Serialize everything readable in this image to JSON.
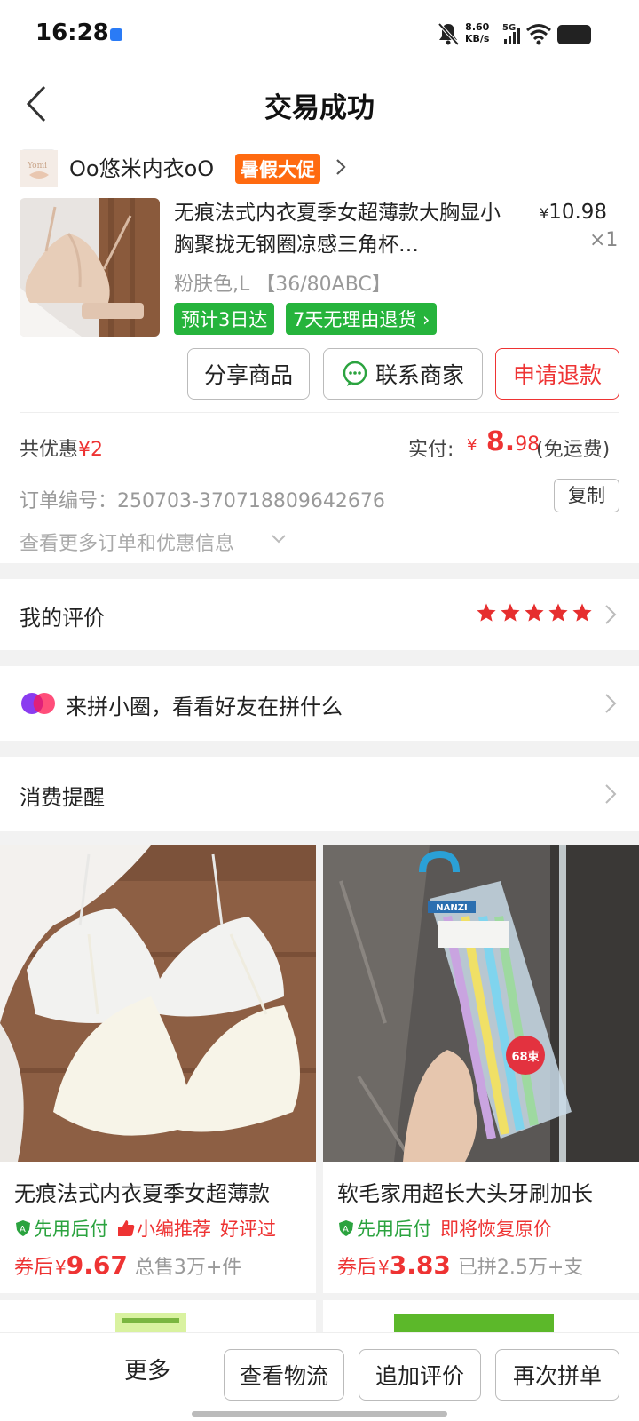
{
  "status_bar": {
    "time": "16:28",
    "net_speed_value": "8.60",
    "net_speed_unit": "KB/s",
    "network": "5G",
    "icons": [
      "app-notification-icon",
      "mute-bell-icon",
      "signal-icon",
      "wifi-icon",
      "battery-icon"
    ]
  },
  "header": {
    "title": "交易成功",
    "back_icon": "chevron-left-icon"
  },
  "order": {
    "shop": {
      "name": "Oo悠米内衣oO",
      "badge": "暑假大促"
    },
    "product": {
      "title": "无痕法式内衣夏季女超薄款大胸显小胸聚拢无钢圈凉感三角杯…",
      "price_currency": "¥",
      "price": "10.98",
      "quantity": "×1",
      "spec": "粉肤色,L 【36/80ABC】",
      "tag_delivery": "预计3日达",
      "tag_return": "7天无理由退货"
    },
    "actions": {
      "share": "分享商品",
      "contact": "联系商家",
      "refund": "申请退款"
    },
    "discount_label": "共优惠",
    "discount_amount": "¥2",
    "paid_label": "实付:",
    "paid_currency": "¥",
    "paid_integer": "8.",
    "paid_decimal": "98",
    "paid_note": "(免运费)",
    "order_number": "订单编号：250703-370718809642676",
    "copy_label": "复制",
    "more_info": "查看更多订单和优惠信息"
  },
  "review": {
    "label": "我的评价",
    "stars": 5
  },
  "circle": {
    "label": "来拼小圈，看看好友在拼什么"
  },
  "reminder": {
    "label": "消费提醒"
  },
  "recommendations": [
    {
      "title": "无痕法式内衣夏季女超薄款",
      "pay_later": "先用后付",
      "tag2": "小编推荐",
      "tag3": "好评过",
      "coupon": "券后",
      "currency": "¥",
      "price": "9.67",
      "sold": "总售3万+件"
    },
    {
      "title": "软毛家用超长大头牙刷加长",
      "pay_later": "先用后付",
      "tag2": "即将恢复原价",
      "coupon": "券后",
      "currency": "¥",
      "price": "3.83",
      "sold": "已拼2.5万+支",
      "package_brand": "NANZI",
      "package_count": "68束"
    }
  ],
  "bottom_bar": {
    "more": "更多",
    "logistics": "查看物流",
    "add_review": "追加评价",
    "reorder": "再次拼单"
  },
  "colors": {
    "accent_red": "#e33333",
    "promo_orange": "#ff6a10",
    "green": "#26b43c",
    "star_red": "#e62e2e"
  }
}
